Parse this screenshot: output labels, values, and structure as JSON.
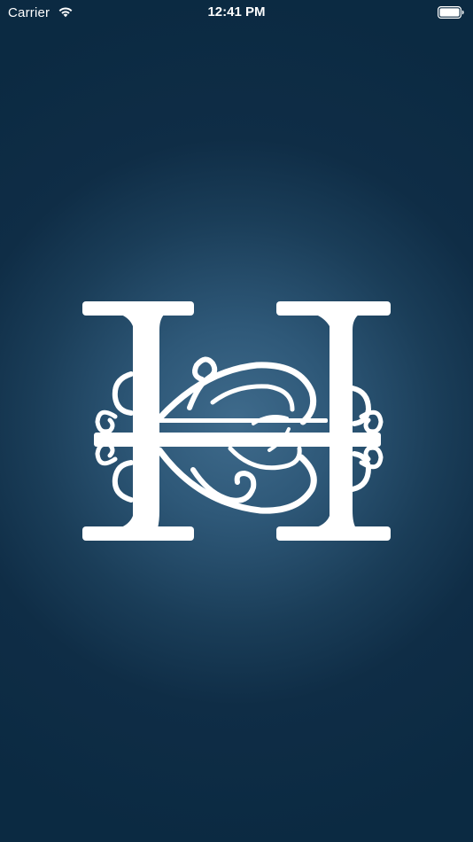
{
  "status_bar": {
    "carrier": "Carrier",
    "time": "12:41 PM",
    "wifi_icon": "wifi-icon",
    "battery_icon": "battery-icon"
  },
  "splash": {
    "logo_icon": "ornamental-monogram-h-logo",
    "colors": {
      "background_outer": "#0b2a42",
      "background_center": "#3f6b8c",
      "logo": "#ffffff"
    }
  }
}
